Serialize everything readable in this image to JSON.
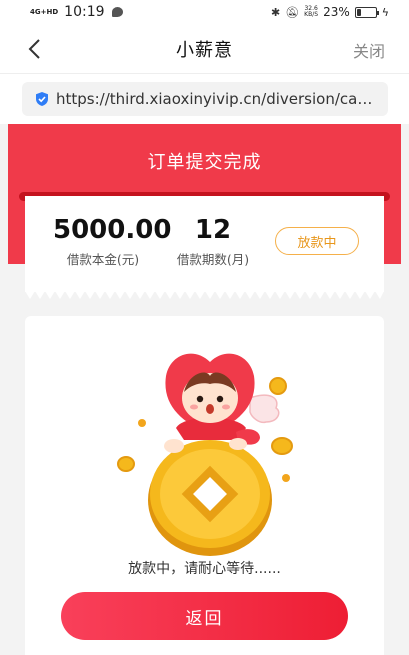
{
  "status_bar": {
    "network": "4G+HD",
    "time": "10:19",
    "speed_value": "32.6",
    "speed_unit": "KB/S",
    "battery": "23%",
    "battery_level": 0.23
  },
  "nav": {
    "title": "小薪意",
    "close_label": "关闭"
  },
  "url_bar": {
    "url": "https://third.xiaoxinyivip.cn/diversion/cas···"
  },
  "header": {
    "title": "订单提交完成"
  },
  "summary": {
    "principal_value": "5000.00",
    "principal_label": "借款本金(元)",
    "term_value": "12",
    "term_label": "借款期数(月)",
    "status": "放款中"
  },
  "main": {
    "illustration": "mascot-on-gold-coin",
    "waiting_message": "放款中，请耐心等待......",
    "return_button": "返回"
  },
  "colors": {
    "brand_red": "#f03a4a",
    "status_orange": "#e8961a",
    "coin_gold": "#f5b81c"
  }
}
